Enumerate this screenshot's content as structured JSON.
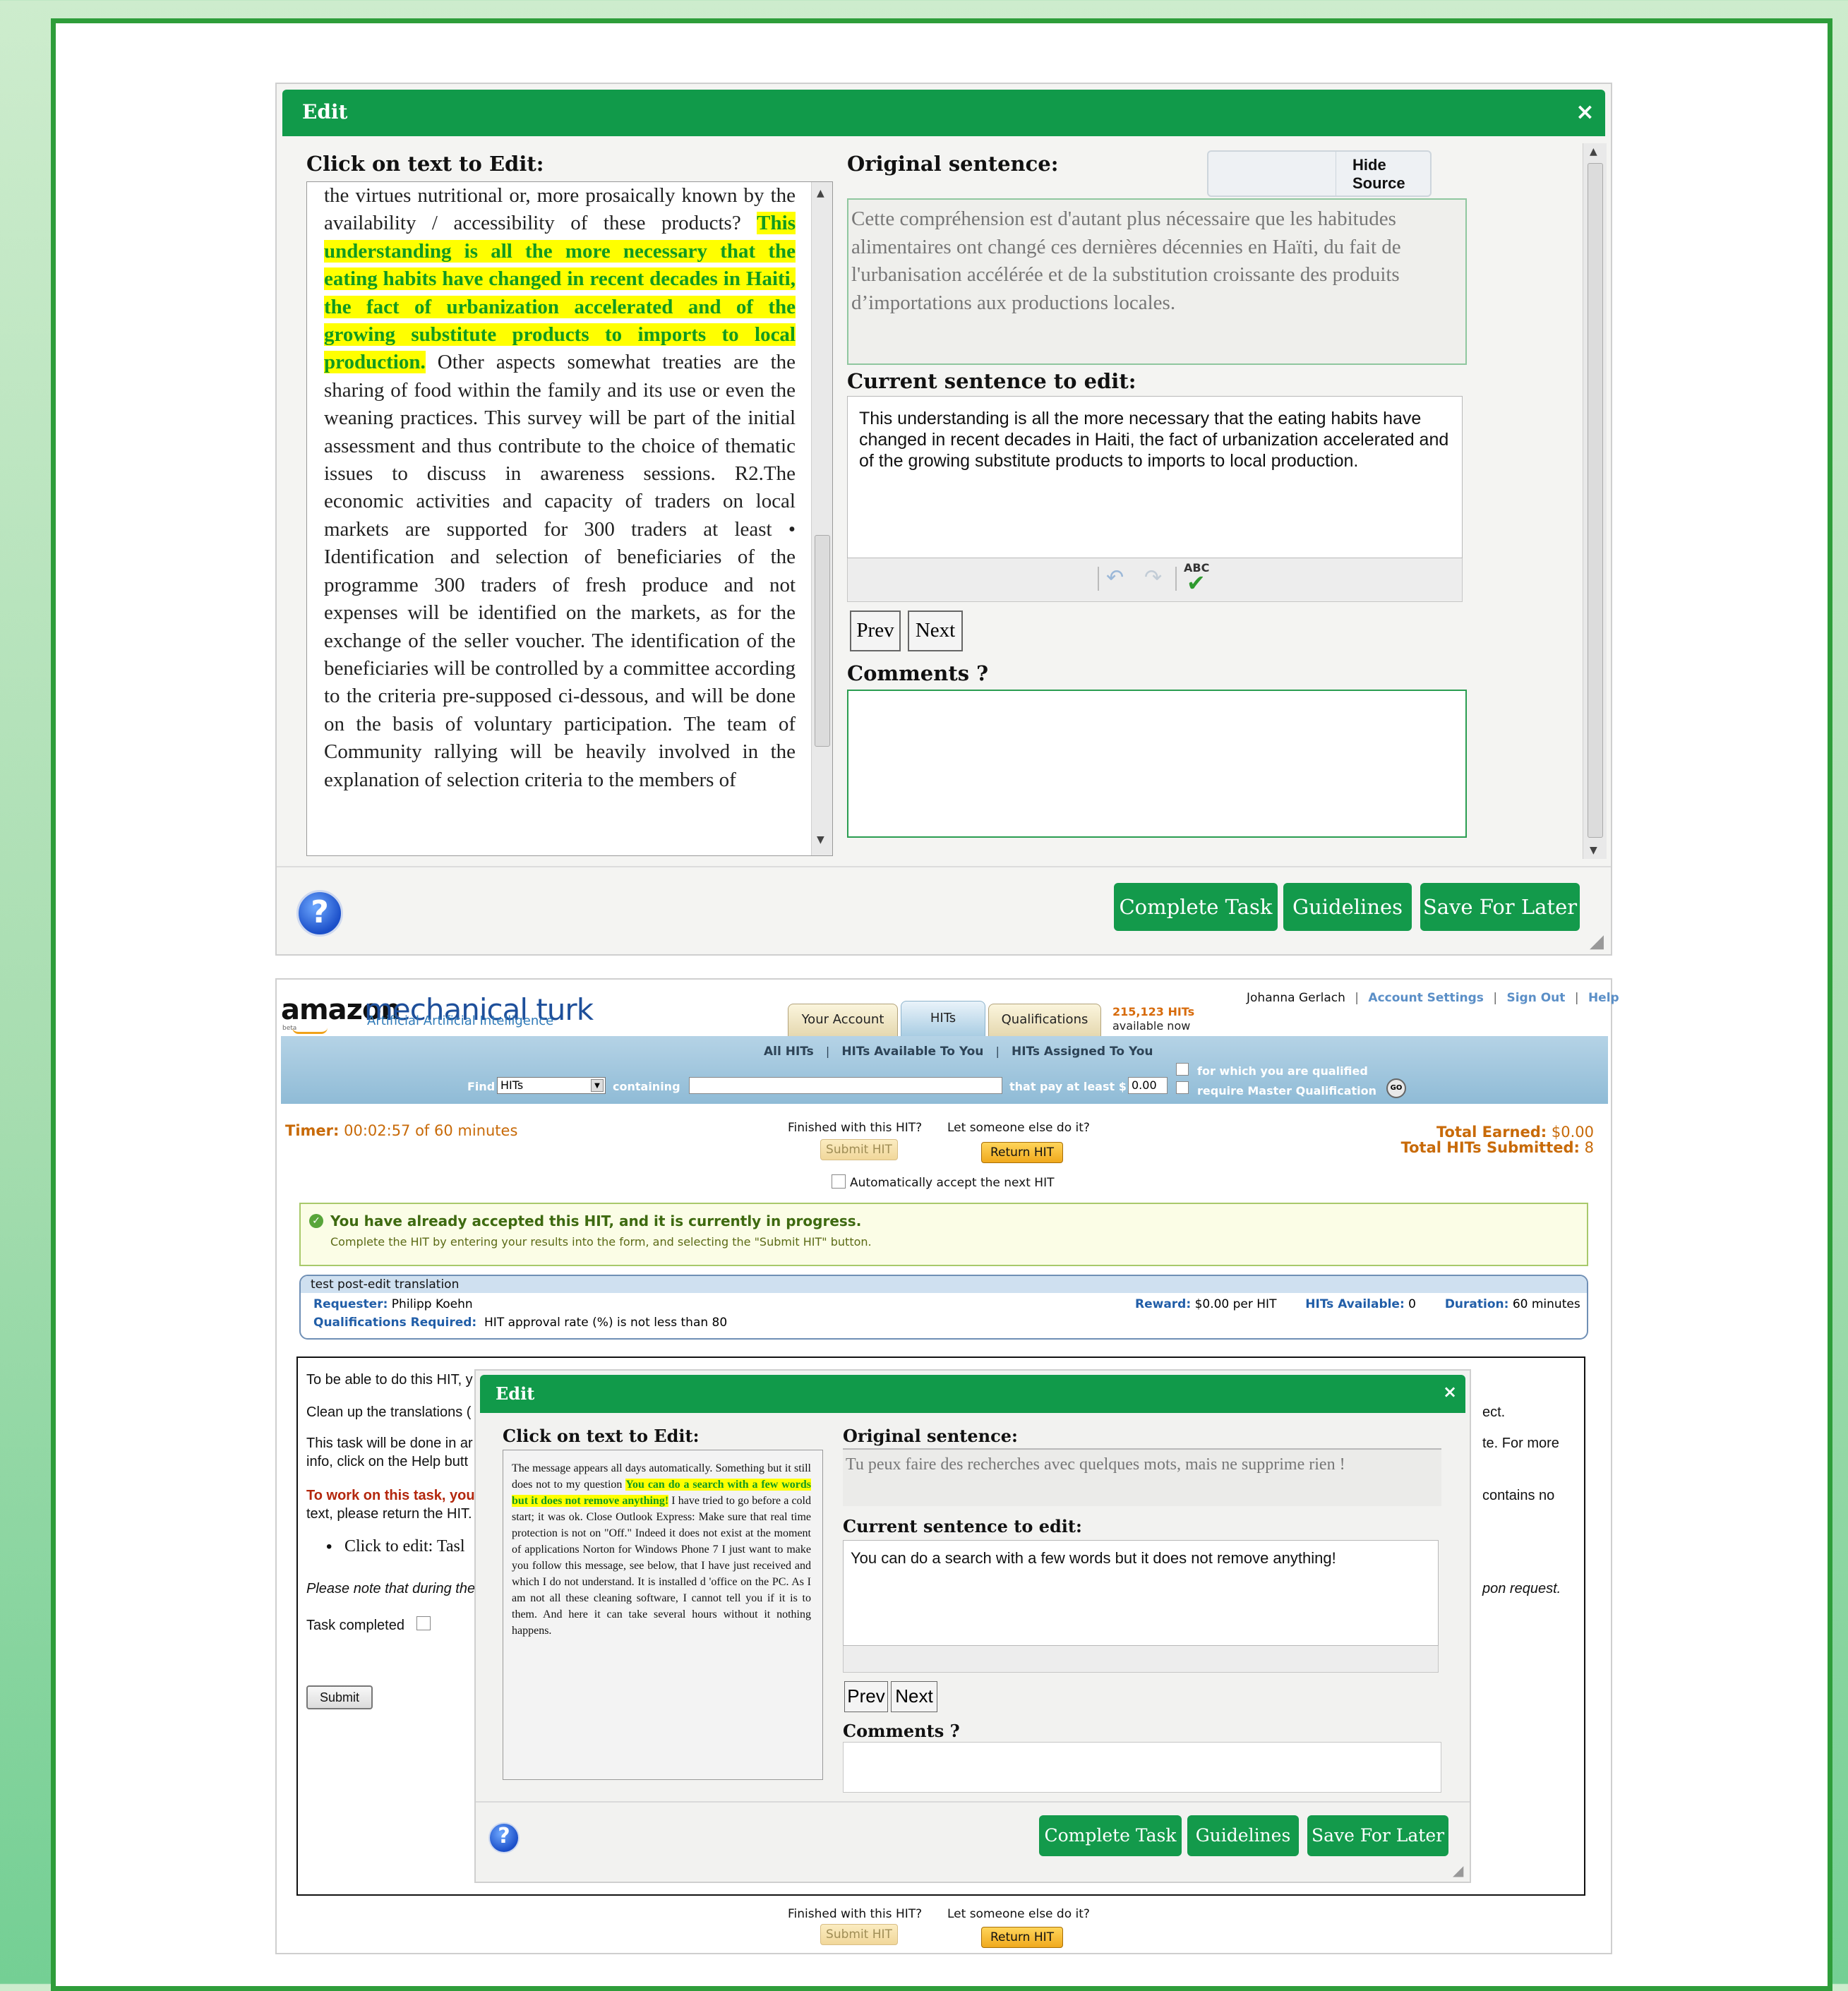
{
  "editor": {
    "title": "Edit",
    "click_label": "Click on text to Edit:",
    "original_label": "Original sentence:",
    "hide_source": "Hide Source",
    "current_label": "Current sentence to edit:",
    "comments_label": "Comments ?",
    "prev": "Prev",
    "next": "Next",
    "complete": "Complete Task",
    "guidelines": "Guidelines",
    "save_later": "Save For Later",
    "help": "?",
    "close": "×"
  },
  "doc1": {
    "before": "the virtues nutritional or, more prosaically known by the availability / accessibility of these products? ",
    "highlight": "This understanding is all the more necessary that the eating habits have changed in recent decades in Haiti, the fact of urbanization accelerated and of the growing substitute products to imports to local production.",
    "after": " Other aspects somewhat treaties are the sharing of food within the family and its use or even the weaning practices. This survey will be part of the initial assessment and thus contribute to the choice of thematic issues to discuss in awareness sessions. R2.The economic activities and capacity of traders on local markets are supported for 300 traders at least • Identification and selection of beneficiaries of the programme 300 traders of fresh produce and not expenses will be identified on the markets, as for the exchange of the seller voucher. The identification of the beneficiaries will be controlled by a committee according to the criteria pre-supposed ci-dessous, and will be done on the basis of voluntary participation. The team of Community rallying will be heavily involved in the explanation of selection criteria to the members of",
    "original": "Cette compréhension est d'autant plus nécessaire que les habitudes alimentaires ont changé ces dernières décennies en Haïti, du fait de l'urbanisation accélérée et de la substitution croissante des produits d’importations aux productions locales.",
    "current": "This understanding is all the more necessary that the eating habits have changed in recent decades in Haiti, the fact of urbanization accelerated and of the growing substitute products to imports to local production."
  },
  "doc2": {
    "before": "The message appears all days automatically. Something but it still does not to my question ",
    "highlight": "You can do a search with a few words but it does not remove anything!",
    "after": " I have tried to go before a cold start; it was ok. Close Outlook Express: Make sure that real time protection is not on \"Off.\" Indeed it does not exist at the moment of applications Norton for Windows Phone 7 I just want to make you follow this message, see below, that I have just received and which I do not understand. It is installed d 'office on the PC. As I am not all these cleaning software, I cannot tell you if it is to them. And here it can take several hours without it nothing happens.",
    "original": "Tu peux faire des recherches avec quelques mots, mais ne supprime rien !",
    "current": "You can do a search with a few words but it does not remove anything!"
  },
  "mturk": {
    "logo_amazon": "amazon",
    "logo_mt": "mechanical turk",
    "logo_sub": "Artificial Artificial Intelligence",
    "logo_beta": "beta",
    "tabs": [
      "Your Account",
      "HITs",
      "Qualifications"
    ],
    "hits_count": "215,123 HITs",
    "hits_avail": "available now",
    "user": "Johanna Gerlach",
    "account_settings": "Account Settings",
    "sign_out": "Sign Out",
    "help": "Help",
    "sub_links": [
      "All HITs",
      "HITs Available To You",
      "HITs Assigned To You"
    ],
    "find": "Find",
    "find_select": "HITs",
    "containing": "containing",
    "pay_label": "that pay at least $",
    "pay_value": "0.00",
    "qualified": "for which you are qualified",
    "master": "require Master Qualification",
    "go": "GO",
    "timer_label": "Timer:",
    "timer_value": "00:02:57 of 60 minutes",
    "finished": "Finished with this HIT?",
    "someone_else": "Let someone else do it?",
    "submit_hit": "Submit HIT",
    "return_hit": "Return HIT",
    "auto_accept": "Automatically accept the next HIT",
    "total_earned_label": "Total Earned:",
    "total_earned": "$0.00",
    "total_submitted_label": "Total HITs Submitted:",
    "total_submitted": "8",
    "notice_title": "You have already accepted this HIT, and it is currently in progress.",
    "notice_body": "Complete the HIT by entering your results into the form, and selecting the \"Submit HIT\" button.",
    "hit_title": "test post-edit translation",
    "requester_label": "Requester:",
    "requester": "Philipp Koehn",
    "qual_label": "Qualifications Required:",
    "qual": "HIT approval rate (%) is not less than 80",
    "reward_label": "Reward:",
    "reward": "$0.00 per HIT",
    "avail_label": "HITs Available:",
    "avail": "0",
    "duration_label": "Duration:",
    "duration": "60 minutes"
  },
  "task": {
    "line1": "To be able to do this HIT, y",
    "line2": "Clean up the translations (",
    "line2_end": "ect.",
    "line3a": "This task will be done in ar",
    "line3_end": "te. For more",
    "line3b": "info, click on the Help butt",
    "line4a": "To work on this task, you",
    "line4_end": "contains no",
    "line4b": "text, please return the HIT.",
    "bullet": "Click to edit: Tasl",
    "note": "Please note that during the",
    "note_end": "pon request.",
    "task_completed": "Task completed",
    "submit": "Submit"
  },
  "colors": {
    "green": "#119a4a",
    "frame": "#2e9d3a",
    "highlight": "#ffff00",
    "orange": "#c86a08"
  }
}
